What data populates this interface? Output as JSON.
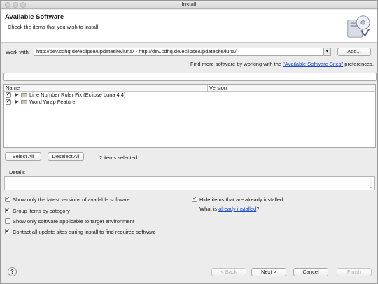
{
  "window": {
    "title": "Install"
  },
  "header": {
    "title": "Available Software",
    "subtitle": "Check the items that you wish to install."
  },
  "work_with": {
    "label": "Work with:",
    "value": "http://dev.cdhq.de/eclipse/updatesite/luna/ - http://dev.cdhq.de/eclipse/updatesite/luna/",
    "add_label": "Add..."
  },
  "find_more": {
    "prefix": "Find more software by working with the ",
    "link": "\"Available Software Sites\"",
    "suffix": " preferences."
  },
  "filter": {
    "value": ""
  },
  "table": {
    "columns": [
      "Name",
      "Version"
    ],
    "rows": [
      {
        "name": "Line Number Ruler Fix (Eclipse Luna 4.4)",
        "version": "",
        "checked": true
      },
      {
        "name": "Word Wrap Feature",
        "version": "",
        "checked": true
      }
    ]
  },
  "selection": {
    "select_all": "Select All",
    "deselect_all": "Deselect All",
    "count_text": "2 items selected"
  },
  "details": {
    "label": "Details",
    "text": ""
  },
  "options": {
    "latest_versions": {
      "label": "Show only the latest versions of available software",
      "checked": true
    },
    "group_by_category": {
      "label": "Group items by category",
      "checked": true
    },
    "target_env": {
      "label": "Show only software applicable to target environment",
      "checked": false
    },
    "contact_sites": {
      "label": "Contact all update sites during install to find required software",
      "checked": true
    },
    "hide_installed": {
      "label": "Hide items that are already installed",
      "checked": true
    },
    "what_is": {
      "prefix": "What is ",
      "link": "already installed",
      "suffix": "?"
    }
  },
  "footer": {
    "help": "?",
    "back": "< Back",
    "next": "Next >",
    "cancel": "Cancel",
    "finish": "Finish"
  },
  "checkmark": "✔"
}
